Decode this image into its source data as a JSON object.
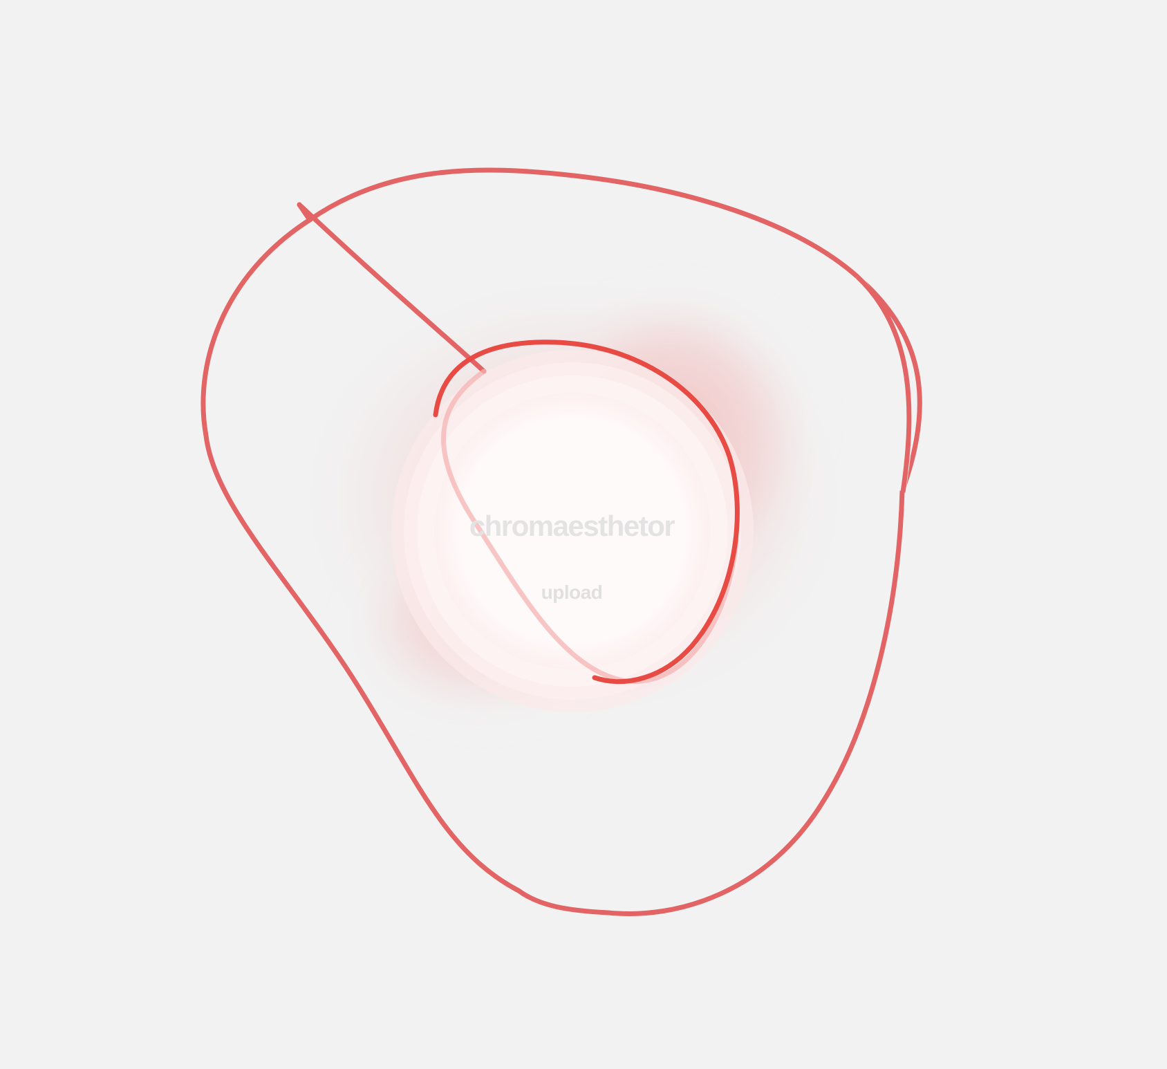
{
  "app": {
    "title": "chromaesthetor",
    "upload_label": "upload"
  },
  "colors": {
    "background": "#f2f2f2",
    "stroke": "#e36464",
    "stroke_strong": "#e8413a",
    "glow": "#f4c7c7",
    "center": "#ffffff",
    "title_text": "#e3e3e3"
  }
}
